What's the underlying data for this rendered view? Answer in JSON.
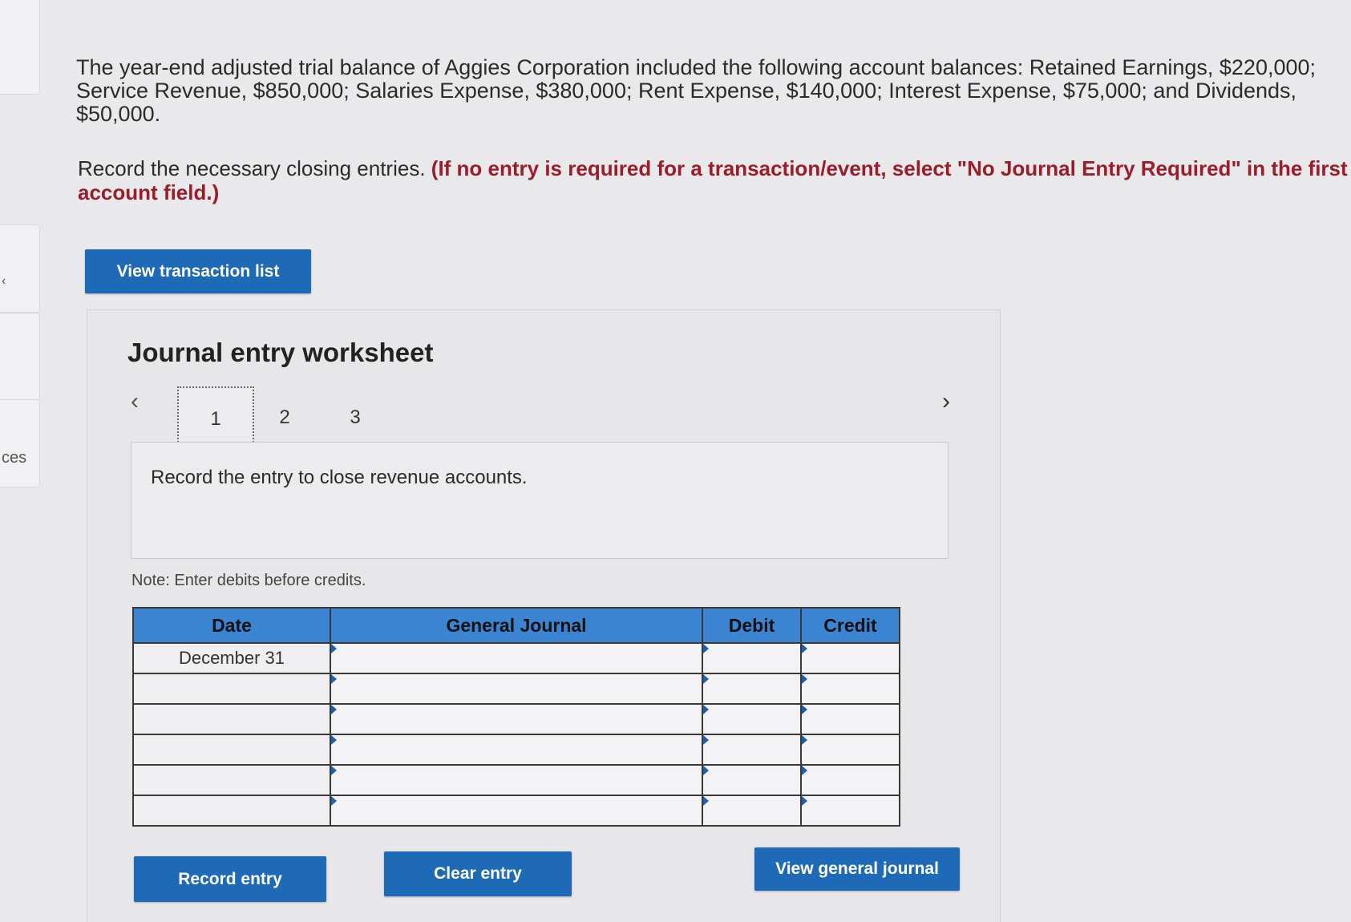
{
  "rail": {
    "arrow": "‹",
    "label": "ces"
  },
  "question_text": "The year-end adjusted trial balance of Aggies Corporation included the following account balances: Retained Earnings, $220,000; Service Revenue, $850,000; Salaries Expense, $380,000; Rent Expense, $140,000; Interest Expense, $75,000; and Dividends, $50,000.",
  "instruction": {
    "text": "Record the necessary closing entries.",
    "emphasis": "(If no entry is required for a transaction/event, select \"No Journal Entry Required\" in the first account field.)"
  },
  "buttons": {
    "view_transaction_list": "View transaction list",
    "record_entry": "Record entry",
    "clear_entry": "Clear entry",
    "view_general_journal": "View general journal"
  },
  "worksheet": {
    "title": "Journal entry worksheet",
    "nav": {
      "prev": "‹",
      "next": "›"
    },
    "tabs": [
      "1",
      "2",
      "3"
    ],
    "active_tab": "1",
    "entry_prompt": "Record the entry to close revenue accounts.",
    "note": "Note: Enter debits before credits."
  },
  "journal": {
    "headers": {
      "date": "Date",
      "general_journal": "General Journal",
      "debit": "Debit",
      "credit": "Credit"
    },
    "rows": [
      {
        "date": "December 31",
        "account": "",
        "debit": "",
        "credit": ""
      },
      {
        "date": "",
        "account": "",
        "debit": "",
        "credit": ""
      },
      {
        "date": "",
        "account": "",
        "debit": "",
        "credit": ""
      },
      {
        "date": "",
        "account": "",
        "debit": "",
        "credit": ""
      },
      {
        "date": "",
        "account": "",
        "debit": "",
        "credit": ""
      },
      {
        "date": "",
        "account": "",
        "debit": "",
        "credit": ""
      }
    ]
  },
  "colors": {
    "button_blue": "#1f6ab6",
    "header_blue": "#3a84d2",
    "emphasis_red": "#9b1c2a"
  }
}
